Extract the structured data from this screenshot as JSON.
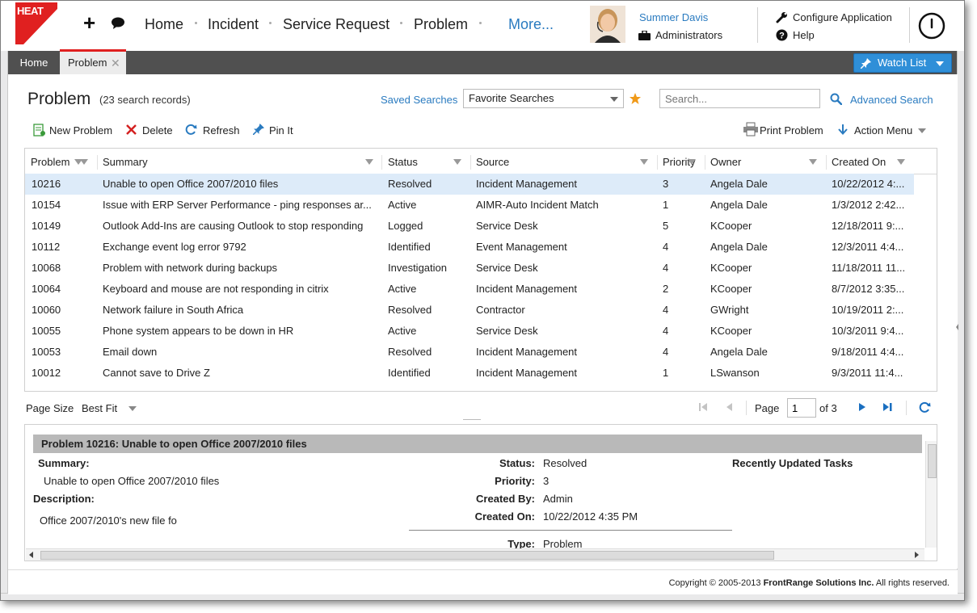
{
  "brand": {
    "logo_text": "HEAT",
    "accent": "#e02020",
    "link_color": "#2a7bc0"
  },
  "topnav": {
    "items": [
      "Home",
      "Incident",
      "Service Request",
      "Problem"
    ],
    "more": "More..."
  },
  "user": {
    "name": "Summer Davis",
    "role": "Administrators"
  },
  "utility": {
    "configure": "Configure Application",
    "help": "Help"
  },
  "tabs": {
    "home": "Home",
    "problem": "Problem"
  },
  "watchlist": {
    "label": "Watch List"
  },
  "page": {
    "title": "Problem",
    "count": "(23 search records)"
  },
  "search": {
    "saved_searches": "Saved Searches",
    "favorite": "Favorite Searches",
    "placeholder": "Search...",
    "advanced": "Advanced Search"
  },
  "toolbar": {
    "new": "New Problem",
    "delete": "Delete",
    "refresh": "Refresh",
    "pin": "Pin It",
    "print": "Print Problem",
    "action_menu": "Action Menu"
  },
  "grid": {
    "columns": [
      "Problem",
      "Summary",
      "Status",
      "Source",
      "Priority",
      "Owner",
      "Created On"
    ],
    "rows": [
      [
        "10216",
        "Unable to open Office 2007/2010 files",
        "Resolved",
        "Incident Management",
        "3",
        "Angela Dale",
        "10/22/2012 4:..."
      ],
      [
        "10154",
        "Issue with ERP Server Performance - ping responses ar...",
        "Active",
        "AIMR-Auto Incident Match",
        "1",
        "Angela Dale",
        "1/3/2012 2:42..."
      ],
      [
        "10149",
        "Outlook Add-Ins are causing Outlook to stop responding",
        "Logged",
        "Service Desk",
        "5",
        "KCooper",
        "12/18/2011 9:..."
      ],
      [
        "10112",
        "Exchange event log error 9792",
        "Identified",
        "Event Management",
        "4",
        "Angela Dale",
        "12/3/2011 4:4..."
      ],
      [
        "10068",
        "Problem with network during backups",
        "Investigation",
        "Service Desk",
        "4",
        "KCooper",
        "11/18/2011 11..."
      ],
      [
        "10064",
        "Keyboard and mouse are not responding in citrix",
        "Active",
        "Incident Management",
        "2",
        "KCooper",
        "8/7/2012 3:35..."
      ],
      [
        "10060",
        "Network failure in South Africa",
        "Resolved",
        "Contractor",
        "4",
        "GWright",
        "10/19/2011 2:..."
      ],
      [
        "10055",
        "Phone system appears to be down in HR",
        "Active",
        "Service Desk",
        "4",
        "KCooper",
        "10/3/2011 9:4..."
      ],
      [
        "10053",
        "Email down",
        "Resolved",
        "Incident Management",
        "4",
        "Angela Dale",
        "9/18/2011 4:4..."
      ],
      [
        "10012",
        "Cannot save to Drive Z",
        "Identified",
        "Incident Management",
        "1",
        "LSwanson",
        "9/3/2011 11:4..."
      ]
    ]
  },
  "pager": {
    "page_size_label": "Page Size",
    "page_size_value": "Best Fit",
    "page_label": "Page",
    "page_value": "1",
    "of": "of 3"
  },
  "detail": {
    "header": "Problem 10216: Unable to open Office 2007/2010 files",
    "summary_label": "Summary:",
    "summary_value": "Unable to open Office 2007/2010 files",
    "description_label": "Description:",
    "description_value": "Office 2007/2010's new file fo",
    "status_label": "Status:",
    "status_value": "Resolved",
    "priority_label": "Priority:",
    "priority_value": "3",
    "created_by_label": "Created By:",
    "created_by_value": "Admin",
    "created_on_label": "Created On:",
    "created_on_value": "10/22/2012 4:35 PM",
    "type_label": "Type:",
    "type_value": "Problem",
    "tasks_label": "Recently Updated Tasks"
  },
  "footer": {
    "copyright_prefix": "Copyright © 2005-2013 ",
    "company": "FrontRange Solutions Inc.",
    "suffix": " All rights reserved."
  }
}
